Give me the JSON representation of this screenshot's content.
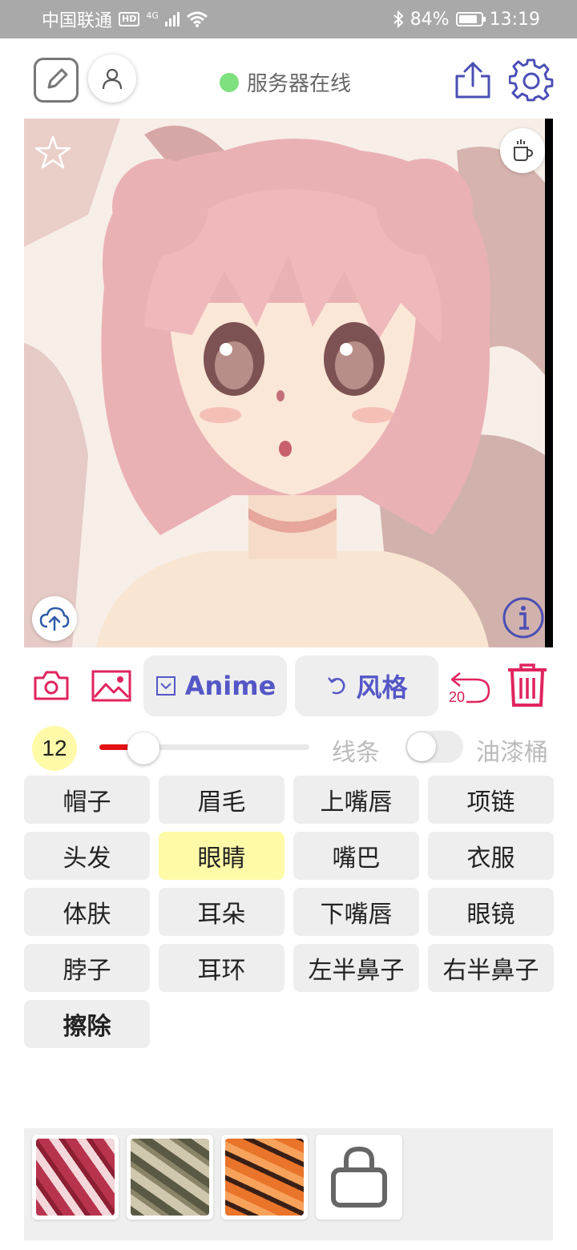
{
  "status_bar": {
    "carrier": "中国联通",
    "hd_badge": "HD",
    "network": "4G",
    "battery": "84%",
    "time": "13:19"
  },
  "toolbar": {
    "server_status": "服务器在线",
    "server_status_color": "#7ee07e",
    "icons": [
      "edit-icon",
      "user-icon",
      "share-icon",
      "gear-icon"
    ]
  },
  "canvas": {
    "overlay_icons": [
      "star-icon",
      "coffee-icon",
      "cloud-upload-icon",
      "info-icon"
    ]
  },
  "actions": {
    "anime_label": "Anime",
    "style_label": "风格",
    "undo_count": "20",
    "accent_color": "#5457c6",
    "alert_color": "#d81b50"
  },
  "brush": {
    "size": "12",
    "slider_fraction": 0.21,
    "line_label": "线条",
    "bucket_label": "油漆桶",
    "bucket_toggle_on": false
  },
  "parts": [
    {
      "label": "帽子",
      "selected": false
    },
    {
      "label": "眉毛",
      "selected": false
    },
    {
      "label": "上嘴唇",
      "selected": false
    },
    {
      "label": "项链",
      "selected": false
    },
    {
      "label": "头发",
      "selected": false
    },
    {
      "label": "眼睛",
      "selected": true
    },
    {
      "label": "嘴巴",
      "selected": false
    },
    {
      "label": "衣服",
      "selected": false
    },
    {
      "label": "体肤",
      "selected": false
    },
    {
      "label": "耳朵",
      "selected": false
    },
    {
      "label": "下嘴唇",
      "selected": false
    },
    {
      "label": "眼镜",
      "selected": false
    },
    {
      "label": "脖子",
      "selected": false
    },
    {
      "label": "耳环",
      "selected": false
    },
    {
      "label": "左半鼻子",
      "selected": false
    },
    {
      "label": "右半鼻子",
      "selected": false
    },
    {
      "label": "擦除",
      "selected": false
    }
  ],
  "palette": {
    "swatches": [
      "pink-pattern",
      "olive-pattern",
      "orange-pattern"
    ],
    "shop_icon": "shopping-bag-icon"
  }
}
